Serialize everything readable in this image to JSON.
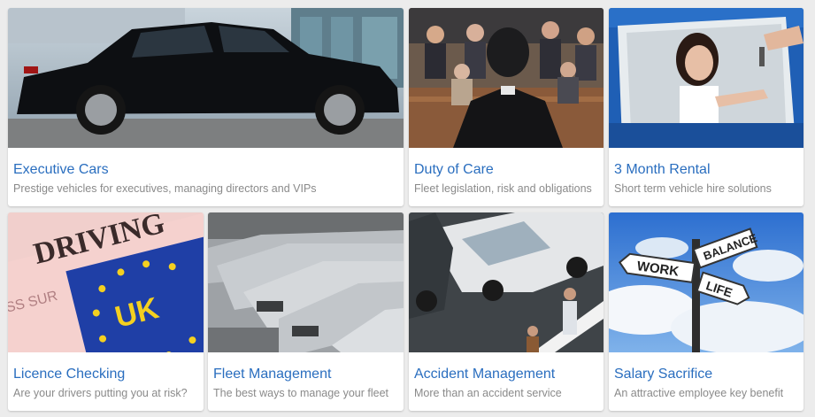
{
  "tiles": [
    {
      "title": "Executive Cars",
      "description": "Prestige vehicles for executives, managing directors and VIPs",
      "image": "black-executive-car"
    },
    {
      "title": "Duty of Care",
      "description": "Fleet legislation, risk and obligations",
      "image": "courtroom"
    },
    {
      "title": "3 Month Rental",
      "description": "Short term vehicle hire solutions",
      "image": "woman-receiving-car-keys"
    },
    {
      "title": "Licence Checking",
      "description": "Are your drivers putting you at risk?",
      "image": "uk-driving-licence",
      "image_text": {
        "word": "DRIVING",
        "country": "UK",
        "edge": "ISS SUR"
      }
    },
    {
      "title": "Fleet Management",
      "description": "The best ways to manage your fleet",
      "image": "parked-fleet-cars"
    },
    {
      "title": "Accident Management",
      "description": "More than an accident service",
      "image": "car-collision"
    },
    {
      "title": "Salary Sacrifice",
      "description": "An attractive employee key benefit",
      "image": "signpost-work-life-balance",
      "image_text": {
        "sign1": "BALANCE",
        "sign2": "WORK",
        "sign3": "LIFE"
      }
    }
  ]
}
